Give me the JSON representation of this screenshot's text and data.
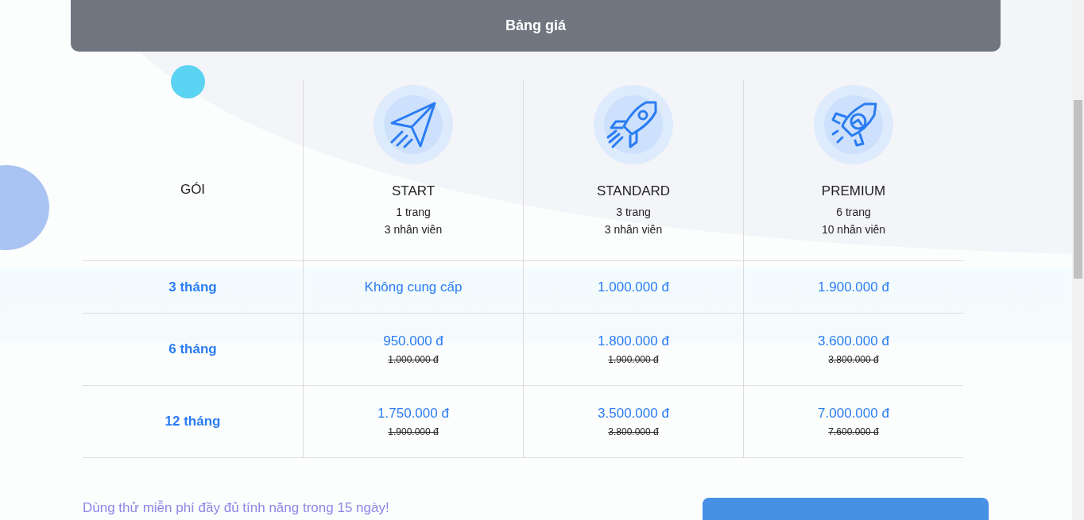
{
  "header": {
    "title": "Bảng giá"
  },
  "table": {
    "corner_label": "GÓI",
    "plans": [
      {
        "kind": "plane",
        "name": "START",
        "pages": "1 trang",
        "staff": "3 nhân viên"
      },
      {
        "kind": "rocket",
        "name": "STANDARD",
        "pages": "3 trang",
        "staff": "3 nhân viên"
      },
      {
        "kind": "rocket-chart",
        "name": "PREMIUM",
        "pages": "6 trang",
        "staff": "10 nhân viên"
      }
    ],
    "rows": [
      {
        "period": "3 tháng",
        "cells": [
          {
            "price": "Không cung cấp"
          },
          {
            "price": "1.000.000 đ"
          },
          {
            "price": "1.900.000 đ"
          }
        ]
      },
      {
        "period": "6 tháng",
        "cells": [
          {
            "price": "950.000 đ",
            "old_price": "1.000.000 đ"
          },
          {
            "price": "1.800.000 đ",
            "old_price": "1.900.000 đ"
          },
          {
            "price": "3.600.000 đ",
            "old_price": "3.800.000 đ"
          }
        ]
      },
      {
        "period": "12 tháng",
        "cells": [
          {
            "price": "1.750.000 đ",
            "old_price": "1.900.000 đ"
          },
          {
            "price": "3.500.000 đ",
            "old_price": "3.800.000 đ"
          },
          {
            "price": "7.000.000 đ",
            "old_price": "7.600.000 đ"
          }
        ]
      }
    ]
  },
  "trial": {
    "text": "Dùng thử miễn phí đầy đủ tính năng trong 15 ngày!"
  }
}
